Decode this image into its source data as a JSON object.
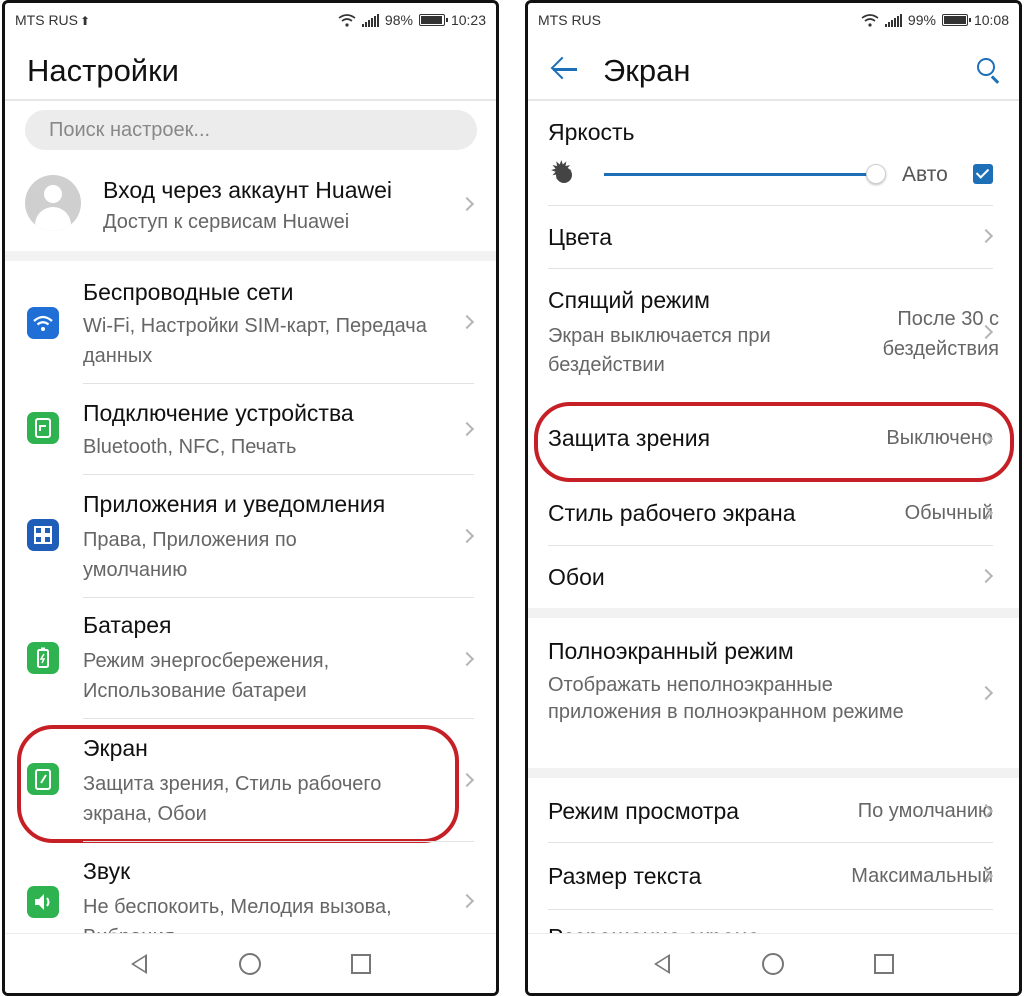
{
  "left": {
    "status": {
      "carrier": "MTS RUS",
      "battery": "98%",
      "time": "10:23",
      "battery_level": 0.98
    },
    "title": "Настройки",
    "search_placeholder": "Поиск настроек...",
    "account": {
      "title": "Вход через аккаунт Huawei",
      "subtitle": "Доступ к сервисам Huawei"
    },
    "items": [
      {
        "label": "Беспроводные сети",
        "sub": "Wi-Fi, Настройки SIM-карт, Передача данных",
        "icon": "wifi-icon",
        "color": "#1f6fd6"
      },
      {
        "label": "Подключение устройства",
        "sub": "Bluetooth, NFC, Печать",
        "icon": "device-connection-icon",
        "color": "#2fb350"
      },
      {
        "label": "Приложения и уведомления",
        "sub": "Права, Приложения по умолчанию",
        "icon": "apps-grid-icon",
        "color": "#1f5eb8"
      },
      {
        "label": "Батарея",
        "sub": "Режим энергосбережения, Использование батареи",
        "icon": "battery-icon",
        "color": "#2fb350"
      },
      {
        "label": "Экран",
        "sub": "Защита зрения, Стиль рабочего экрана, Обои",
        "icon": "display-icon",
        "color": "#2fb350"
      },
      {
        "label": "Звук",
        "sub": "Не беспокоить, Мелодия вызова, Вибрация",
        "icon": "speaker-icon",
        "color": "#2fb350"
      }
    ],
    "highlight_color": "#c62026"
  },
  "right": {
    "status": {
      "carrier": "MTS RUS",
      "battery": "99%",
      "time": "10:08",
      "battery_level": 0.99
    },
    "title": "Экран",
    "brightness": {
      "label": "Яркость",
      "auto_label": "Авто",
      "auto_checked": true,
      "level": 0.97
    },
    "items": [
      {
        "label": "Цвета"
      },
      {
        "label": "Спящий режим",
        "sub": "Экран выключается при бездействии",
        "value": "После 30 с бездействия"
      },
      {
        "label": "Защита зрения",
        "value": "Выключено"
      },
      {
        "label": "Стиль рабочего экрана",
        "value": "Обычный"
      },
      {
        "label": "Обои"
      },
      {
        "label": "Полноэкранный режим",
        "sub": "Отображать неполноэкранные приложения в полноэкранном режиме"
      },
      {
        "label": "Режим просмотра",
        "value": "По умолчанию"
      },
      {
        "label": "Размер текста",
        "value": "Максимальный"
      },
      {
        "label": "Разрешение экрана"
      }
    ],
    "accent_color": "#1d6fb8",
    "highlight_color": "#c62026"
  }
}
